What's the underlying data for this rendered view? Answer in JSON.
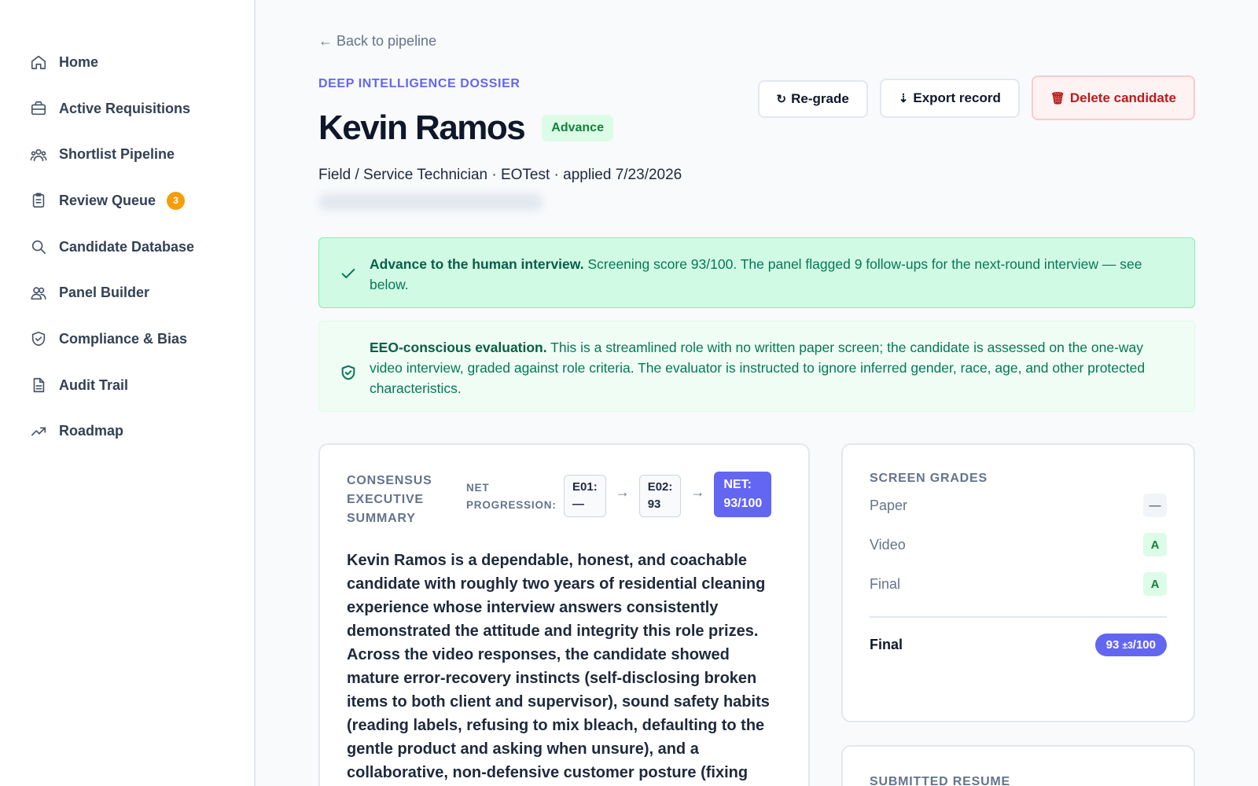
{
  "sidebar": {
    "items": [
      {
        "label": "Home",
        "icon": "home-icon"
      },
      {
        "label": "Active Requisitions",
        "icon": "briefcase-icon"
      },
      {
        "label": "Shortlist Pipeline",
        "icon": "users-icon"
      },
      {
        "label": "Review Queue",
        "icon": "clipboard-icon",
        "badge": "3"
      },
      {
        "label": "Candidate Database",
        "icon": "search-icon"
      },
      {
        "label": "Panel Builder",
        "icon": "user-group-icon"
      },
      {
        "label": "Compliance & Bias",
        "icon": "shield-icon"
      },
      {
        "label": "Audit Trail",
        "icon": "document-icon"
      },
      {
        "label": "Roadmap",
        "icon": "trend-icon"
      }
    ]
  },
  "header": {
    "back_label": "← Back to pipeline",
    "kicker": "DEEP INTELLIGENCE DOSSIER",
    "candidate_name": "Kevin Ramos",
    "status": "Advance",
    "subtitle": "Field / Service Technician · EOTest · applied 7/23/2026"
  },
  "actions": {
    "regrade_icon": "↻",
    "regrade": "Re-grade",
    "export_icon": "⇣",
    "export": "Export record",
    "delete_icon": "🗑",
    "delete": "Delete candidate"
  },
  "alerts": {
    "advance_title": "Advance to the human interview.",
    "advance_body": " Screening score 93/100. The panel flagged 9 follow-ups for the next-round interview — see below.",
    "eeo_title": "EEO-conscious evaluation.",
    "eeo_body": " This is a streamlined role with no written paper screen; the candidate is assessed on the one-way video interview, graded against role criteria. The evaluator is instructed to ignore inferred gender, race, age, and other protected characteristics."
  },
  "summary": {
    "title": "CONSENSUS EXECUTIVE SUMMARY",
    "net_label": "NET PROGRESSION:",
    "e01_label": "E01:",
    "e01_value": "—",
    "e02_label": "E02:",
    "e02_value": "93",
    "arrow": "→",
    "net_label_box": "NET:",
    "net_value": "93/100",
    "text": "Kevin Ramos is a dependable, honest, and coachable candidate with roughly two years of residential cleaning experience whose interview answers consistently demonstrated the attitude and integrity this role prizes. Across the video responses, the candidate showed mature error-recovery instincts (self-disclosing broken items to both client and supervisor), sound safety habits (reading labels, refusing to mix bleach, defaulting to the gentle product and asking when unsure), and a collaborative, non-defensive customer posture (fixing"
  },
  "grades": {
    "title": "SCREEN GRADES",
    "rows": [
      {
        "label": "Paper",
        "grade": "—"
      },
      {
        "label": "Video",
        "grade": "A"
      },
      {
        "label": "Final",
        "grade": "A"
      }
    ],
    "final_label": "Final",
    "final_score": "93",
    "final_margin": "±3",
    "final_denominator": "/100"
  },
  "resume": {
    "title": "SUBMITTED RESUME"
  },
  "colors": {
    "accent": "#6366f1",
    "success": "#047857",
    "danger": "#b91c1c",
    "badge": "#f59e0b"
  }
}
